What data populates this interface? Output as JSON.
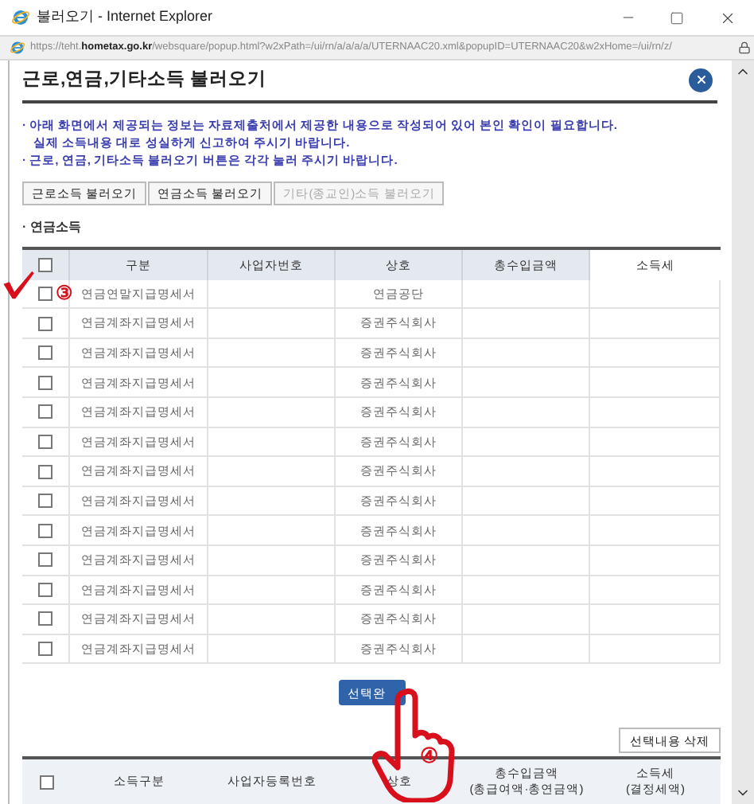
{
  "window": {
    "title": "불러오기 - Internet Explorer"
  },
  "address_bar": {
    "url": "https://teht.**hometax.go.kr**/websquare/popup.html?w2xPath=/ui/rn/a/a/a/a/UTERNAAC20.xml&popupID=UTERNAAC20&w2xHome=/ui/rn/z/"
  },
  "dialog": {
    "title": "근로,연금,기타소득 불러오기"
  },
  "notes": [
    {
      "kind": "bullet",
      "text": "· 아래 화면에서 제공되는 정보는 자료제출처에서 제공한 내용으로 작성되어 있어 본인 확인이 필요합니다."
    },
    {
      "kind": "continuation",
      "text": "실제 소득내용 대로 성실하게 신고하여 주시기 바랍니다."
    },
    {
      "kind": "bullet",
      "text": "· 근로, 연금, 기타소득 불러오기 버튼은 각각 눌러 주시기 바랍니다."
    }
  ],
  "load_buttons": [
    {
      "label": "근로소득 불러오기",
      "disabled": false
    },
    {
      "label": "연금소득 불러오기",
      "disabled": false
    },
    {
      "label": "기타(종교인)소득 불러오기",
      "disabled": true
    }
  ],
  "section": {
    "label": "· 연금소득"
  },
  "table": {
    "header_checked": false,
    "columns": [
      "구분",
      "사업자번호",
      "상호",
      "총수입금액",
      "소득세"
    ],
    "rows": [
      {
        "checked": false,
        "cells": [
          "연금연말지급명세서",
          "",
          "연금공단",
          "",
          ""
        ]
      },
      {
        "checked": false,
        "cells": [
          "연금계좌지급명세서",
          "",
          "증권주식회사",
          "",
          ""
        ]
      },
      {
        "checked": false,
        "cells": [
          "연금계좌지급명세서",
          "",
          "증권주식회사",
          "",
          ""
        ]
      },
      {
        "checked": false,
        "cells": [
          "연금계좌지급명세서",
          "",
          "증권주식회사",
          "",
          ""
        ]
      },
      {
        "checked": false,
        "cells": [
          "연금계좌지급명세서",
          "",
          "증권주식회사",
          "",
          ""
        ]
      },
      {
        "checked": false,
        "cells": [
          "연금계좌지급명세서",
          "",
          "증권주식회사",
          "",
          ""
        ]
      },
      {
        "checked": false,
        "cells": [
          "연금계좌지급명세서",
          "",
          "증권주식회사",
          "",
          ""
        ]
      },
      {
        "checked": false,
        "cells": [
          "연금계좌지급명세서",
          "",
          "증권주식회사",
          "",
          ""
        ]
      },
      {
        "checked": false,
        "cells": [
          "연금계좌지급명세서",
          "",
          "증권주식회사",
          "",
          ""
        ]
      },
      {
        "checked": false,
        "cells": [
          "연금계좌지급명세서",
          "",
          "증권주식회사",
          "",
          ""
        ]
      },
      {
        "checked": false,
        "cells": [
          "연금계좌지급명세서",
          "",
          "증권주식회사",
          "",
          ""
        ]
      },
      {
        "checked": false,
        "cells": [
          "연금계좌지급명세서",
          "",
          "증권주식회사",
          "",
          ""
        ]
      },
      {
        "checked": false,
        "cells": [
          "연금계좌지급명세서",
          "",
          "증권주식회사",
          "",
          ""
        ]
      }
    ]
  },
  "select_button": {
    "label": "선택완"
  },
  "delete_button": {
    "label": "선택내용 삭제"
  },
  "selected_table": {
    "header_checked": false,
    "columns": [
      [
        "소득구분"
      ],
      [
        "사업자등록번호"
      ],
      [
        "상호"
      ],
      [
        "총수입금액",
        "(총급여액·총연금액)"
      ],
      [
        "소득세",
        "(결정세액)"
      ]
    ]
  },
  "annotations": [
    {
      "kind": "check",
      "label": "③"
    },
    {
      "kind": "hand",
      "label": "④"
    }
  ]
}
